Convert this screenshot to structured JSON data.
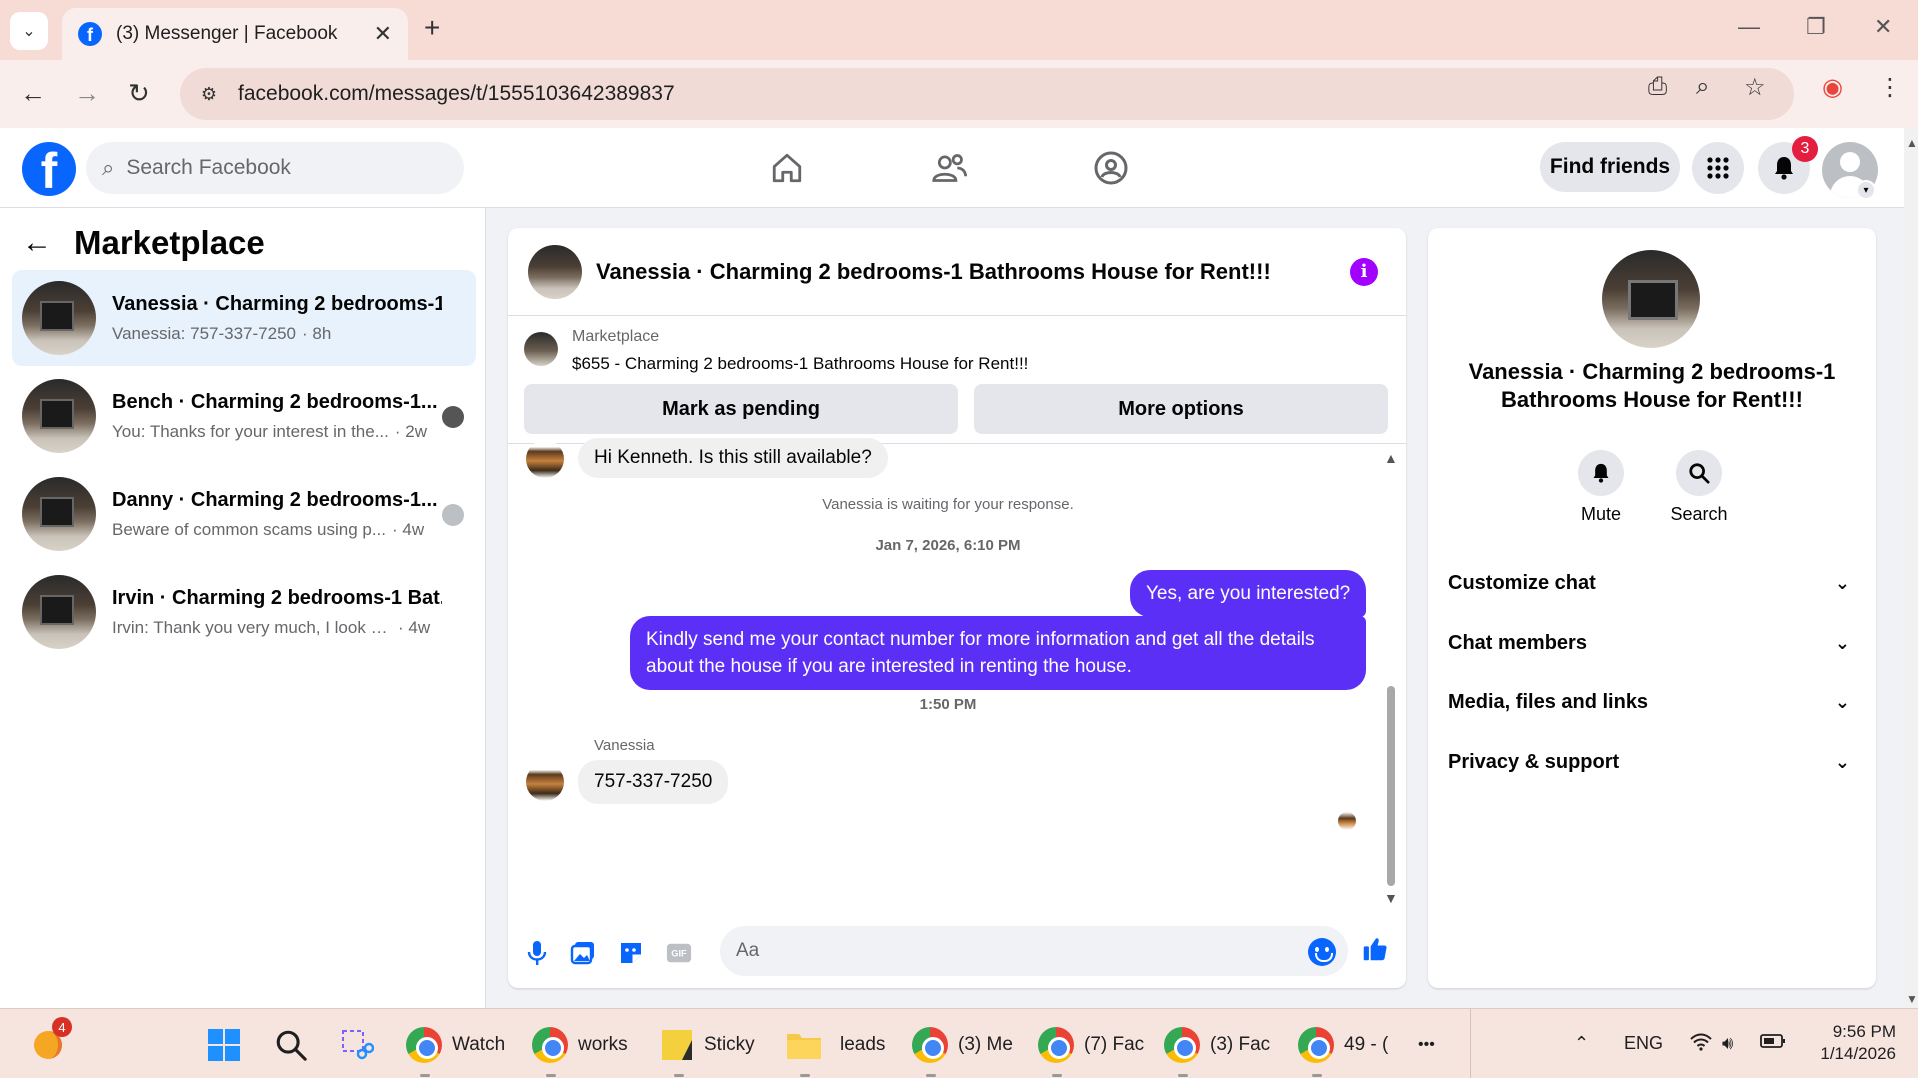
{
  "browser": {
    "tab_title": "(3) Messenger | Facebook",
    "url": "facebook.com/messages/t/1555103642389837"
  },
  "fb_header": {
    "search_placeholder": "Search Facebook",
    "find_friends": "Find friends",
    "notification_count": "3"
  },
  "sidebar": {
    "title": "Marketplace",
    "conversations": [
      {
        "name": "Vanessia · Charming 2 bedrooms-1...",
        "snippet": "Vanessia: 757-337-7250",
        "time": "· 8h",
        "active": true
      },
      {
        "name": "Bench · Charming 2 bedrooms-1...",
        "snippet": "You: Thanks for your interest in the...",
        "time": "· 2w"
      },
      {
        "name": "Danny · Charming 2 bedrooms-1...",
        "snippet": "Beware of common scams using p...",
        "time": "· 4w"
      },
      {
        "name": "Irvin · Charming 2 bedrooms-1 Bat...",
        "snippet": "Irvin: Thank you very much, I look for...",
        "time": "· 4w"
      }
    ]
  },
  "chat": {
    "title": "Vanessia · Charming 2 bedrooms-1 Bathrooms House for Rent!!!",
    "marketplace_label": "Marketplace",
    "listing": "$655 - Charming 2 bedrooms-1 Bathrooms House for Rent!!!",
    "mark_pending": "Mark as pending",
    "more_options": "More options",
    "messages": {
      "first_incoming": "Hi Kenneth. Is this still available?",
      "waiting_notice": "Vanessia is waiting for your response.",
      "timestamp_1": "Jan 7, 2026, 6:10 PM",
      "outgoing_1": "Yes, are you interested?",
      "outgoing_2": "Kindly send me your contact number for more information and get all the details about the house if you are interested in renting the house.",
      "timestamp_2": "1:50 PM",
      "sender_name": "Vanessia",
      "last_incoming": "757-337-7250"
    },
    "composer_placeholder": "Aa"
  },
  "details_panel": {
    "title": "Vanessia · Charming 2 bedrooms-1 Bathrooms House for Rent!!!",
    "mute": "Mute",
    "search": "Search",
    "sections": [
      "Customize chat",
      "Chat members",
      "Media, files and links",
      "Privacy & support"
    ]
  },
  "taskbar": {
    "weather_badge": "4",
    "items": [
      "Watch",
      "works",
      "Sticky",
      "leads",
      "(3) Me",
      "(7) Fac",
      "(3) Fac",
      "49 - ("
    ],
    "more": "•••",
    "language": "ENG",
    "time": "9:56 PM",
    "date": "1/14/2026"
  },
  "colors": {
    "fb_blue": "#0866ff",
    "outgoing_bubble": "#5b2ff5",
    "info_purple": "#a200ff",
    "notification_red": "#e41e3f"
  }
}
